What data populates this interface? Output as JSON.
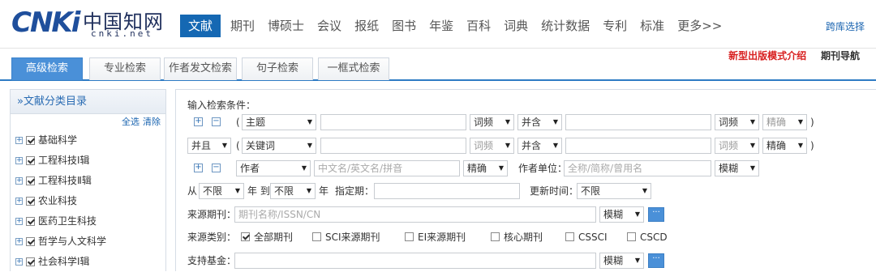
{
  "logo": {
    "mark": "CNKi",
    "name": "中国知网",
    "url": "cnki.net"
  },
  "nav": {
    "items": [
      "文献",
      "期刊",
      "博硕士",
      "会议",
      "报纸",
      "图书",
      "年鉴",
      "百科",
      "词典",
      "统计数据",
      "专利",
      "标准",
      "更多>>"
    ],
    "active": "文献"
  },
  "cross_db": "跨库选择",
  "tabs": [
    "高级检索",
    "专业检索",
    "作者发文检索",
    "句子检索",
    "一框式检索"
  ],
  "right_links": {
    "intro": "新型出版模式介绍",
    "journal_nav": "期刊导航"
  },
  "sidebar": {
    "title": "»文献分类目录",
    "select_all": "全选",
    "clear": "清除",
    "items": [
      "基础科学",
      "工程科技Ⅰ辑",
      "工程科技Ⅱ辑",
      "农业科技",
      "医药卫生科技",
      "哲学与人文科学",
      "社会科学Ⅰ辑"
    ]
  },
  "form": {
    "heading": "输入检索条件：",
    "row1": {
      "paren_open": "(",
      "field": "主题",
      "freq": "词频",
      "op": "并含",
      "freq2": "词频",
      "match": "精确",
      "paren_close": ")"
    },
    "row2": {
      "logic": "并且",
      "paren_open": "(",
      "field": "关键词",
      "freq": "词频",
      "op": "并含",
      "freq2": "词频",
      "match": "精确",
      "paren_close": ")"
    },
    "row3": {
      "field": "作者",
      "placeholder": "中文名/英文名/拼音",
      "match": "精确",
      "unit_label": "作者单位：",
      "unit_placeholder": "全称/简称/曾用名",
      "unit_match": "模糊"
    },
    "row4": {
      "from": "从",
      "from_val": "不限",
      "year1": "年 到",
      "to_val": "不限",
      "year2": "年",
      "date_label": "指定期：",
      "update_label": "更新时间：",
      "update_val": "不限"
    },
    "row5": {
      "label": "来源期刊：",
      "placeholder": "期刊名称/ISSN/CN",
      "match": "模糊",
      "more": "···"
    },
    "row6": {
      "label": "来源类别：",
      "options": [
        {
          "text": "全部期刊",
          "checked": true
        },
        {
          "text": "SCI来源期刊",
          "checked": false
        },
        {
          "text": "EI来源期刊",
          "checked": false
        },
        {
          "text": "核心期刊",
          "checked": false
        },
        {
          "text": "CSSCI",
          "checked": false
        },
        {
          "text": "CSCD",
          "checked": false
        }
      ]
    },
    "row7": {
      "label": "支持基金：",
      "match": "模糊",
      "more": "···"
    }
  }
}
